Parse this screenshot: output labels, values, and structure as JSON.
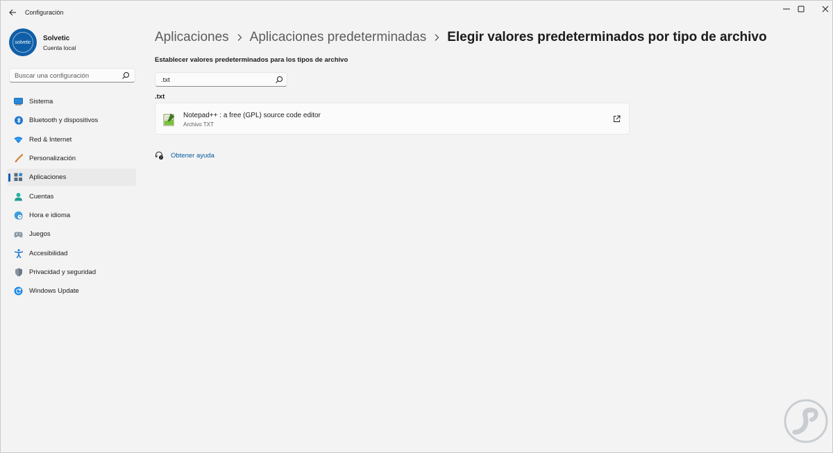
{
  "titlebar": {
    "title": "Configuración"
  },
  "profile": {
    "name": "Solvetic",
    "account_type": "Cuenta local",
    "avatar_text": "solvetic"
  },
  "sidebar": {
    "search_placeholder": "Buscar una configuración",
    "items": [
      {
        "label": "Sistema",
        "icon": "monitor-icon",
        "selected": false
      },
      {
        "label": "Bluetooth y dispositivos",
        "icon": "bluetooth-icon",
        "selected": false
      },
      {
        "label": "Red & Internet",
        "icon": "wifi-icon",
        "selected": false
      },
      {
        "label": "Personalización",
        "icon": "brush-icon",
        "selected": false
      },
      {
        "label": "Aplicaciones",
        "icon": "apps-icon",
        "selected": true
      },
      {
        "label": "Cuentas",
        "icon": "person-icon",
        "selected": false
      },
      {
        "label": "Hora e idioma",
        "icon": "globe-clock-icon",
        "selected": false
      },
      {
        "label": "Juegos",
        "icon": "gamepad-icon",
        "selected": false
      },
      {
        "label": "Accesibilidad",
        "icon": "accessibility-icon",
        "selected": false
      },
      {
        "label": "Privacidad y seguridad",
        "icon": "shield-icon",
        "selected": false
      },
      {
        "label": "Windows Update",
        "icon": "update-icon",
        "selected": false
      }
    ]
  },
  "main": {
    "breadcrumb": {
      "level1": "Aplicaciones",
      "level2": "Aplicaciones predeterminadas",
      "current": "Elegir valores predeterminados por tipo de archivo"
    },
    "section_label": "Establecer valores predeterminados para los tipos de archivo",
    "type_search_value": ".txt",
    "extension": ".txt",
    "app": {
      "name": "Notepad++ : a free (GPL) source code editor",
      "file_type": "Archivo TXT"
    },
    "help_link": "Obtener ayuda"
  },
  "colors": {
    "accent": "#005fb8",
    "background": "#f3f3f3",
    "card": "#fbfbfb",
    "link": "#005a9e"
  }
}
